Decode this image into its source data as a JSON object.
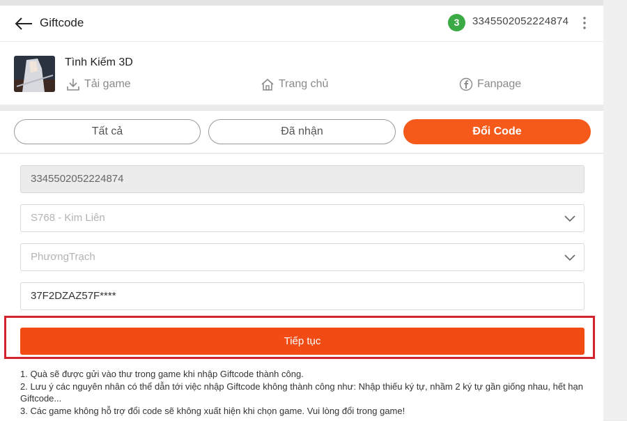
{
  "header": {
    "title": "Giftcode",
    "badge_count": "3",
    "account_id": "3345502052224874"
  },
  "game": {
    "name": "Tình Kiếm 3D",
    "links": [
      {
        "label": "Tải game",
        "icon": "download-icon"
      },
      {
        "label": "Trang chủ",
        "icon": "home-icon"
      },
      {
        "label": "Fanpage",
        "icon": "facebook-icon"
      }
    ]
  },
  "tabs": [
    {
      "label": "Tất cả",
      "active": false
    },
    {
      "label": "Đã nhận",
      "active": false
    },
    {
      "label": "Đổi Code",
      "active": true
    }
  ],
  "form": {
    "account_field": "3345502052224874",
    "server_select": "S768 - Kim Liên",
    "character_select": "PhươngTrạch",
    "code_field": "37F2DZAZ57F****",
    "submit_label": "Tiếp tục"
  },
  "notes": [
    "1. Quà sẽ được gửi vào thư trong game khi nhập Giftcode thành công.",
    "2. Lưu ý các nguyên nhân có thể dẫn tới việc nhập Giftcode không thành công như: Nhập thiếu ký tự, nhầm 2 ký tự gần giống nhau, hết hạn Giftcode...",
    "3. Các game không hỗ trợ đổi code sẽ không xuất hiện khi chọn game. Vui lòng đổi trong game!"
  ],
  "colors": {
    "accent": "#f55a1b",
    "button": "#f24c14",
    "badge": "#3aaa45",
    "highlight": "#d3232e"
  }
}
